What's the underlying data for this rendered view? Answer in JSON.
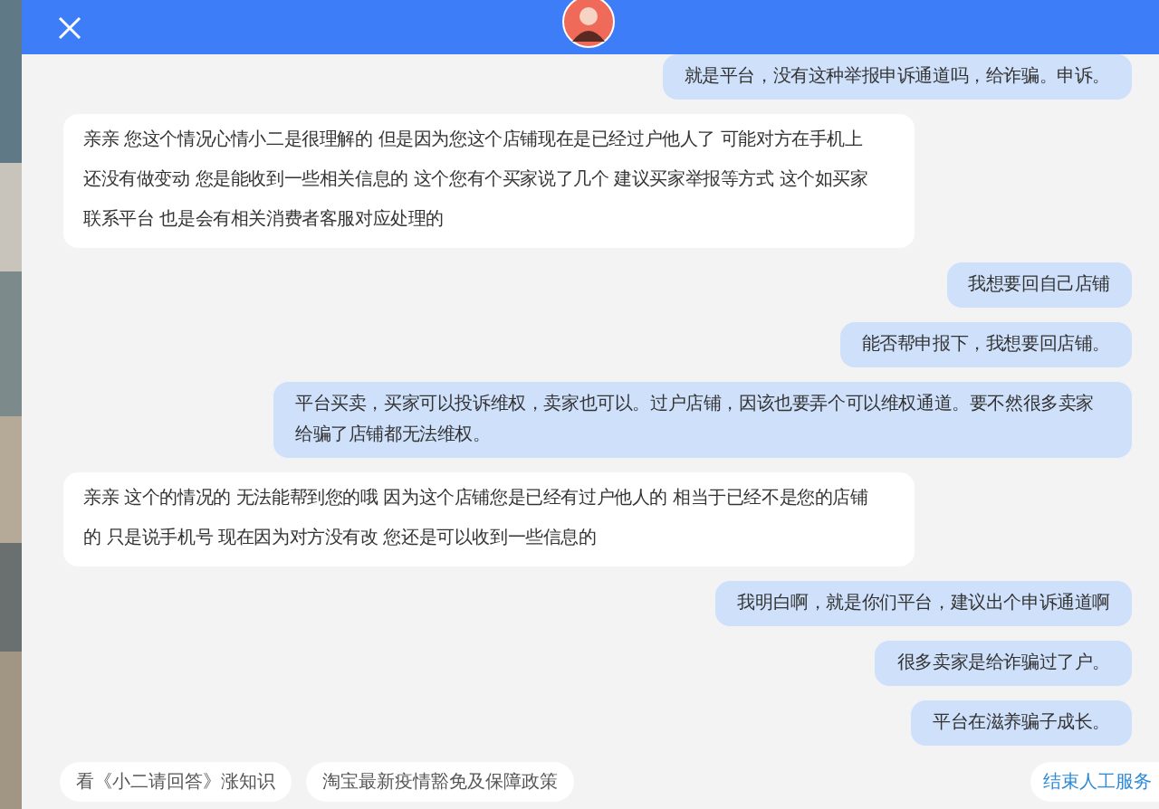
{
  "messages": [
    {
      "kind": "user",
      "text": "就是平台，没有这种举报申诉通道吗，给诈骗。申诉。"
    },
    {
      "kind": "agent",
      "text": "亲亲 您这个情况心情小二是很理解的 但是因为您这个店铺现在是已经过户他人了 可能对方在手机上还没有做变动 您是能收到一些相关信息的 这个您有个买家说了几个 建议买家举报等方式 这个如买家联系平台 也是会有相关消费者客服对应处理的"
    },
    {
      "kind": "user",
      "text": "我想要回自己店铺"
    },
    {
      "kind": "user",
      "text": "能否帮申报下，我想要回店铺。"
    },
    {
      "kind": "user",
      "text": "平台买卖，买家可以投诉维权，卖家也可以。过户店铺，因该也要弄个可以维权通道。要不然很多卖家给骗了店铺都无法维权。"
    },
    {
      "kind": "agent",
      "text": "亲亲 这个的情况的 无法能帮到您的哦 因为这个店铺您是已经有过户他人的 相当于已经不是您的店铺的 只是说手机号 现在因为对方没有改 您还是可以收到一些信息的"
    },
    {
      "kind": "user",
      "text": "我明白啊，就是你们平台，建议出个申诉通道啊"
    },
    {
      "kind": "user",
      "text": "很多卖家是给诈骗过了户。"
    },
    {
      "kind": "user",
      "text": "平台在滋养骗子成长。"
    }
  ],
  "quick_replies": [
    "看《小二请回答》涨知识",
    "淘宝最新疫情豁免及保障政策"
  ],
  "end_button": "结束人工服务"
}
